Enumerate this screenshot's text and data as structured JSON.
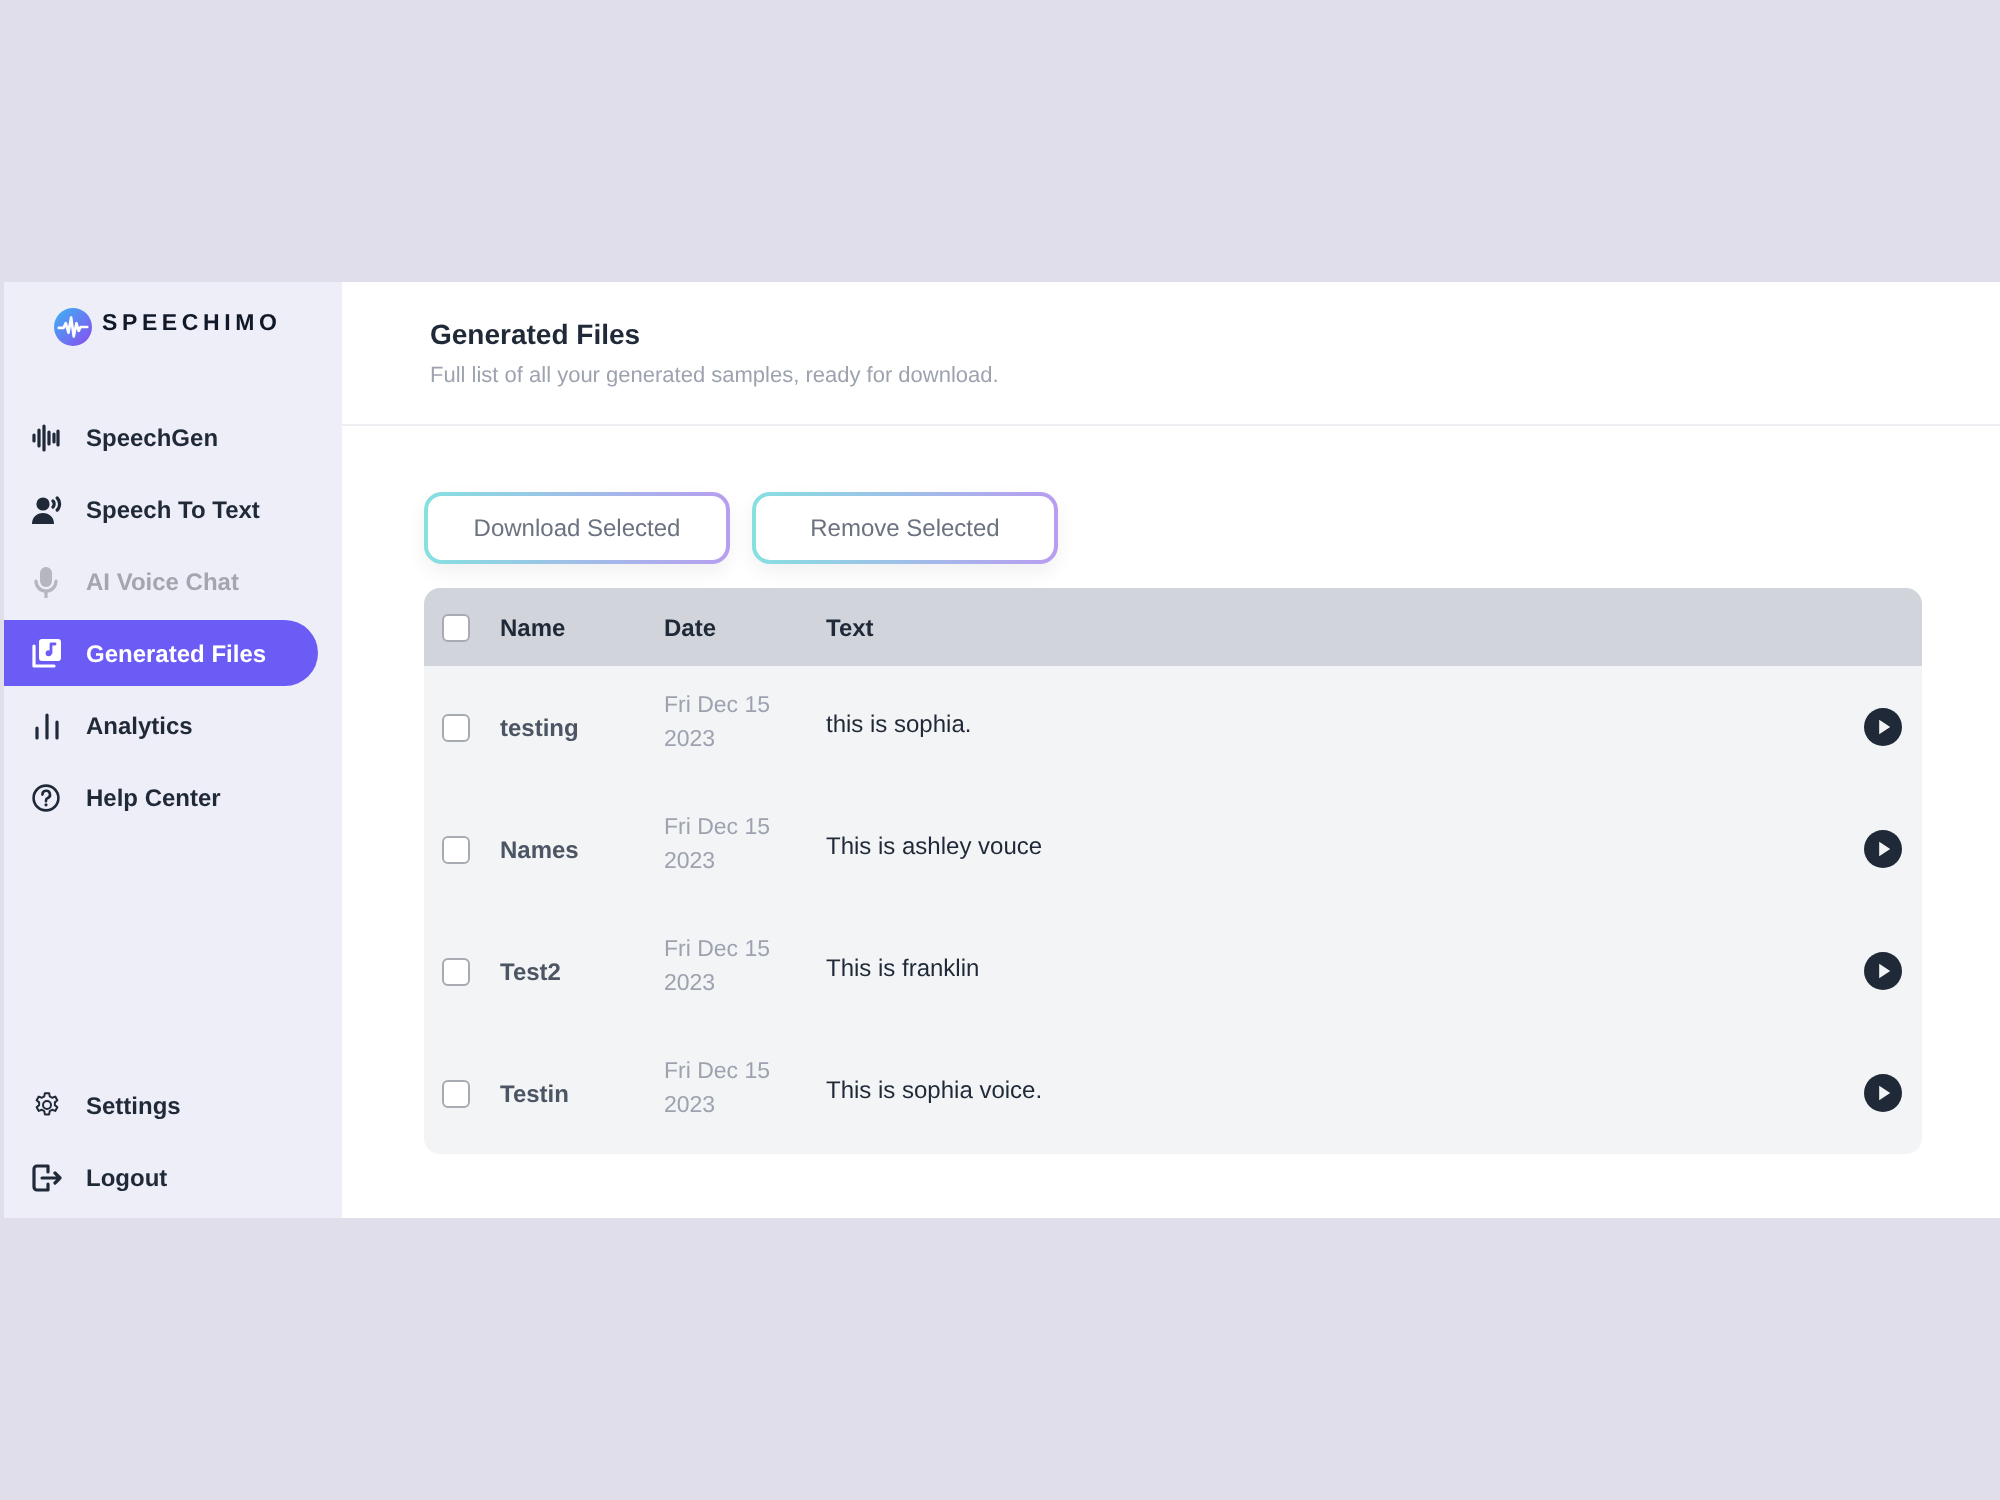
{
  "logo": {
    "text": "SPEECHIMO"
  },
  "sidebar": {
    "items": [
      {
        "label": "SpeechGen",
        "selected": false,
        "disabled": false
      },
      {
        "label": "Speech To Text",
        "selected": false,
        "disabled": false
      },
      {
        "label": "AI Voice Chat",
        "selected": false,
        "disabled": true
      },
      {
        "label": "Generated Files",
        "selected": true,
        "disabled": false
      },
      {
        "label": "Analytics",
        "selected": false,
        "disabled": false
      },
      {
        "label": "Help Center",
        "selected": false,
        "disabled": false
      }
    ],
    "footer_items": [
      {
        "label": "Settings",
        "selected": false
      },
      {
        "label": "Logout",
        "selected": false
      }
    ]
  },
  "header": {
    "title": "Generated Files",
    "subtitle": "Full list of all your generated samples, ready for download."
  },
  "actions": [
    "Download Selected",
    "Remove Selected"
  ],
  "table": {
    "select_all_checked": false,
    "columns": [
      "Name",
      "Date",
      "Text"
    ],
    "rows": [
      {
        "name": "testing",
        "date": "Fri Dec 15 2023",
        "text": "this is sophia.",
        "checked": false
      },
      {
        "name": "Names",
        "date": "Fri Dec 15 2023",
        "text": "This is ashley vouce",
        "checked": false
      },
      {
        "name": "Test2",
        "date": "Fri Dec 15 2023",
        "text": "This is franklin",
        "checked": false
      },
      {
        "name": "Testin",
        "date": "Fri Dec 15 2023",
        "text": "This is sophia voice.",
        "checked": false
      }
    ]
  }
}
